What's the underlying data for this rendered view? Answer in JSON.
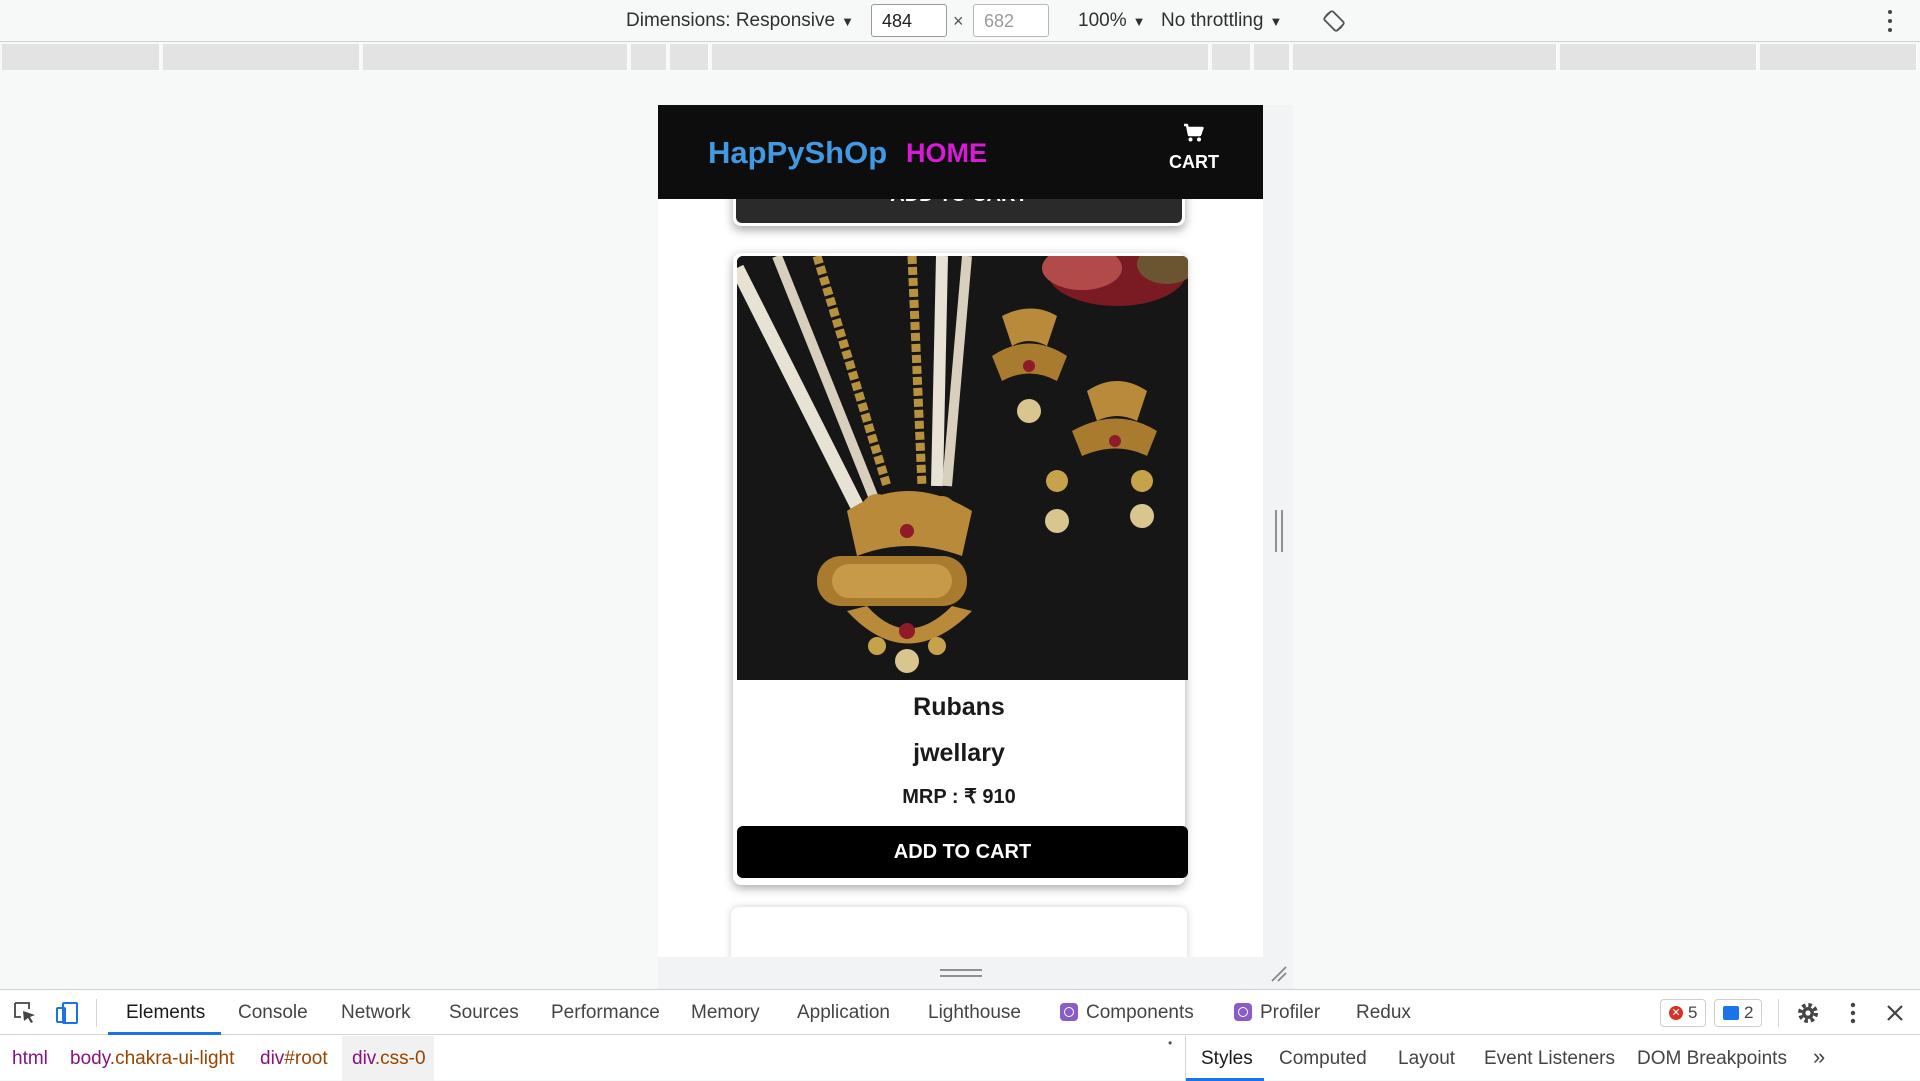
{
  "device_toolbar": {
    "dimensions_label": "Dimensions: Responsive",
    "width": "484",
    "height_placeholder": "682",
    "times": "×",
    "zoom": "100%",
    "throttling": "No throttling",
    "caret": "▼",
    "icons": [
      "rotate-icon",
      "more-options-icon"
    ]
  },
  "app": {
    "brand": "HapPyShOp",
    "nav_home": "HOME",
    "nav_cart": "CART",
    "cart_icon": "cart-icon",
    "colors": {
      "brand": "#4299e1",
      "home": "#d91bd9",
      "navbar": "#0d0d0d"
    },
    "previous_card_button": "ADD TO CART",
    "product": {
      "title": "Rubans",
      "category": "jwellary",
      "price": "MRP : ₹ 910",
      "button": "ADD TO CART"
    }
  },
  "devtools": {
    "tabs": [
      "Elements",
      "Console",
      "Network",
      "Sources",
      "Performance",
      "Memory",
      "Application",
      "Lighthouse",
      "Components",
      "Profiler",
      "Redux"
    ],
    "active_tab": "Elements",
    "error_count": "5",
    "message_count": "2",
    "breadcrumbs": {
      "html": "html",
      "body_tag": "body",
      "body_class": ".chakra-ui-light",
      "root_tag": "div",
      "root_id": "#root",
      "css_tag": "div",
      "css_class": ".css-0"
    },
    "styles_tabs": [
      "Styles",
      "Computed",
      "Layout",
      "Event Listeners",
      "DOM Breakpoints"
    ],
    "more": "»"
  }
}
